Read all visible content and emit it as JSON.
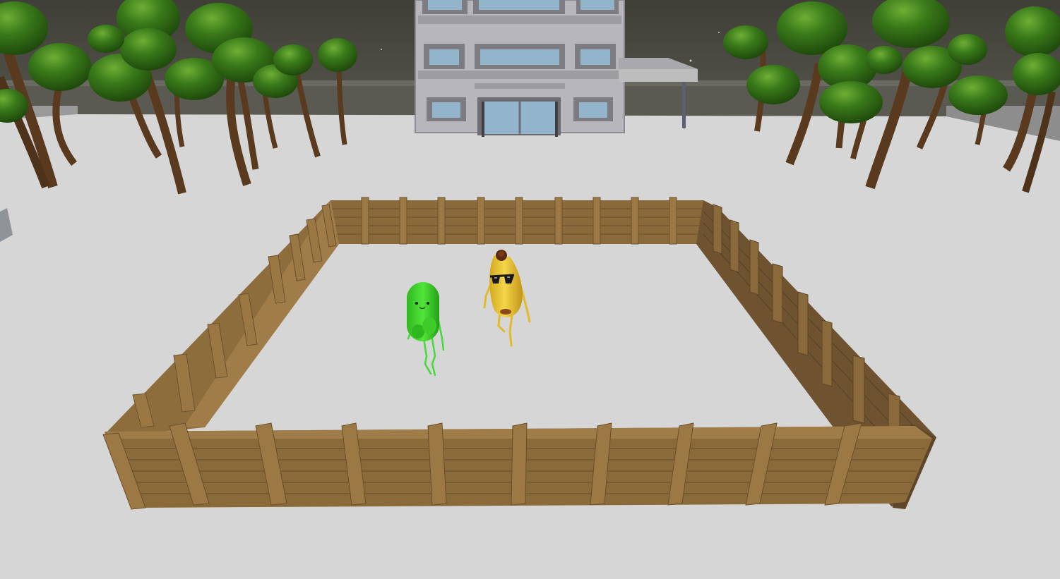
{
  "scene": {
    "colors": {
      "sky": "#4a4a42",
      "ground": "#d6d6d6",
      "wall_outer": "#5e5d55",
      "wall_cap": "#b9b9b9",
      "building": "#b8b8bc",
      "building_frame": "#7b7b80",
      "window": "#8fb3cc",
      "trunk": "#5a3a1e",
      "canopy": "#2f6414",
      "canopy_highlight": "#5f9a2c",
      "fence": "#8b6a3c",
      "fence_dark": "#6e522b",
      "fence_light": "#a47f4a",
      "pickle": "#3ccf2a",
      "pickle_dark": "#24a418",
      "banana": "#e8c230",
      "banana_dark": "#c79a1c",
      "glasses": "#1a1a1a"
    },
    "characters": [
      {
        "id": "pickle",
        "icon": "pickle-character"
      },
      {
        "id": "banana",
        "icon": "banana-character-with-sunglasses"
      }
    ]
  }
}
